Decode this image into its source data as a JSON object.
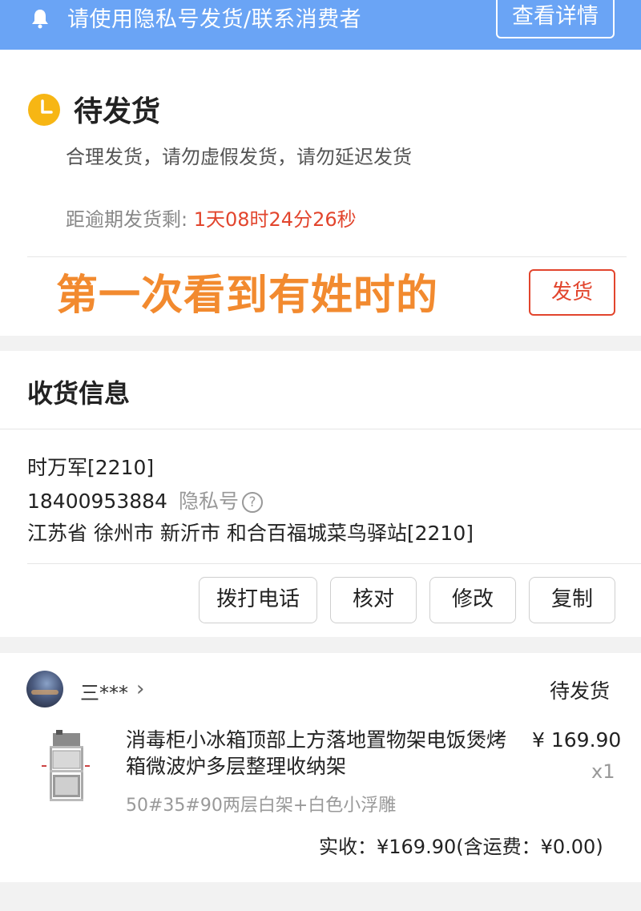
{
  "banner": {
    "text": "请使用隐私号发货/联系消费者",
    "detail_button": "查看详情",
    "bg_color": "#6aa4f5",
    "icon": "bell-icon"
  },
  "status": {
    "title": "待发货",
    "description": "合理发货，请勿虚假发货，请勿延迟发货",
    "deadline_label": "距逾期发货剩:",
    "countdown": "1天08时24分26秒",
    "overlay_caption": "第一次看到有姓时的",
    "ship_button": "发货",
    "icon": "clock-icon",
    "accent_color": "#e2452d"
  },
  "address": {
    "section_title": "收货信息",
    "name": "时万军[2210]",
    "phone": "18400953884",
    "privacy_label": "隐私号",
    "help_glyph": "?",
    "address": "江苏省 徐州市 新沂市 和合百福城菜鸟驿站[2210]",
    "actions": [
      "拨打电话",
      "核对",
      "修改",
      "复制"
    ]
  },
  "order": {
    "shop_name": "三***",
    "chevron": "›",
    "status": "待发货",
    "product_name": "消毒柜小冰箱顶部上方落地置物架电饭煲烤箱微波炉多层整理收纳架",
    "price": "¥ 169.90",
    "quantity": "x1",
    "sku": "50#35#90两层白架+白色小浮雕",
    "total": "实收：¥169.90(含运费：¥0.00)"
  }
}
